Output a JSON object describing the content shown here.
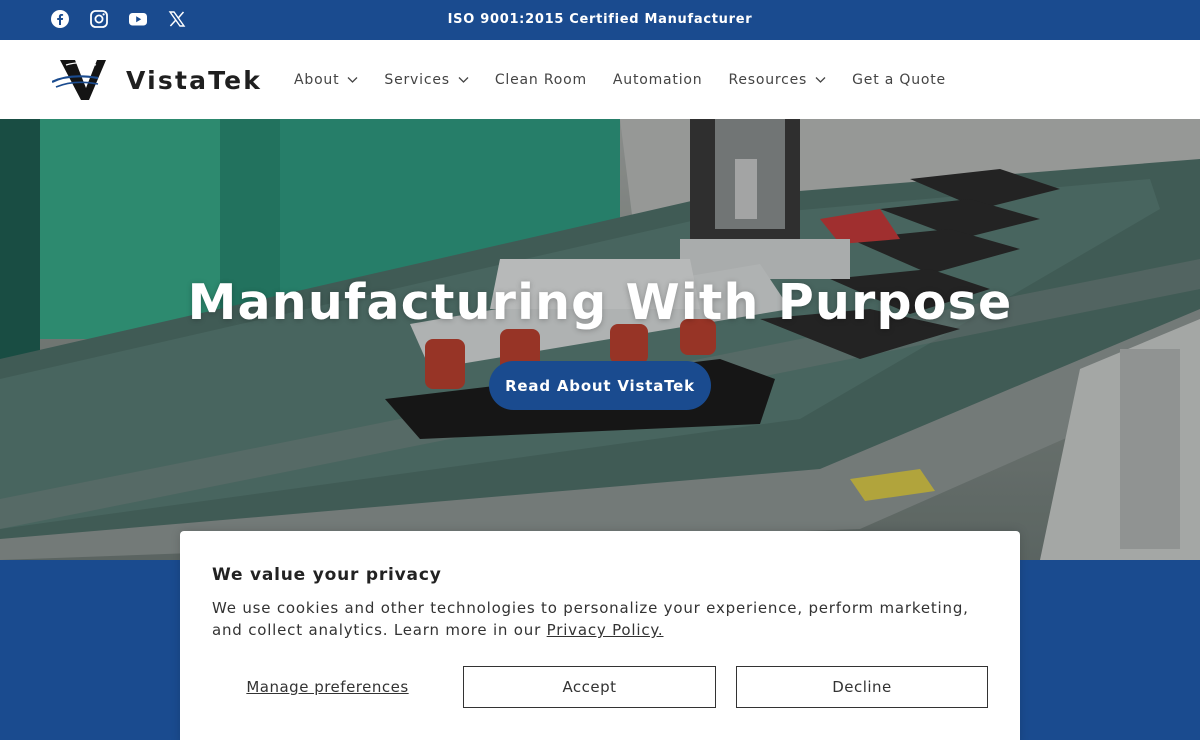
{
  "topbar": {
    "announcement": "ISO 9001:2015 Certified Manufacturer",
    "social": [
      "facebook-icon",
      "instagram-icon",
      "youtube-icon",
      "x-icon"
    ],
    "color": "#1a4b8f"
  },
  "header": {
    "logo_text": "VistaTek",
    "nav": [
      {
        "label": "About",
        "has_dropdown": true
      },
      {
        "label": "Services",
        "has_dropdown": true
      },
      {
        "label": "Clean Room",
        "has_dropdown": false
      },
      {
        "label": "Automation",
        "has_dropdown": false
      },
      {
        "label": "Resources",
        "has_dropdown": true
      },
      {
        "label": "Get a Quote",
        "has_dropdown": false
      }
    ]
  },
  "hero": {
    "title": "Manufacturing With Purpose",
    "button": "Read About VistaTek"
  },
  "cookie": {
    "title": "We value your privacy",
    "body": "We use cookies and other technologies to personalize your experience, perform marketing, and collect analytics. Learn more in our",
    "link": "Privacy Policy.",
    "manage": "Manage preferences",
    "accept": "Accept",
    "decline": "Decline"
  }
}
